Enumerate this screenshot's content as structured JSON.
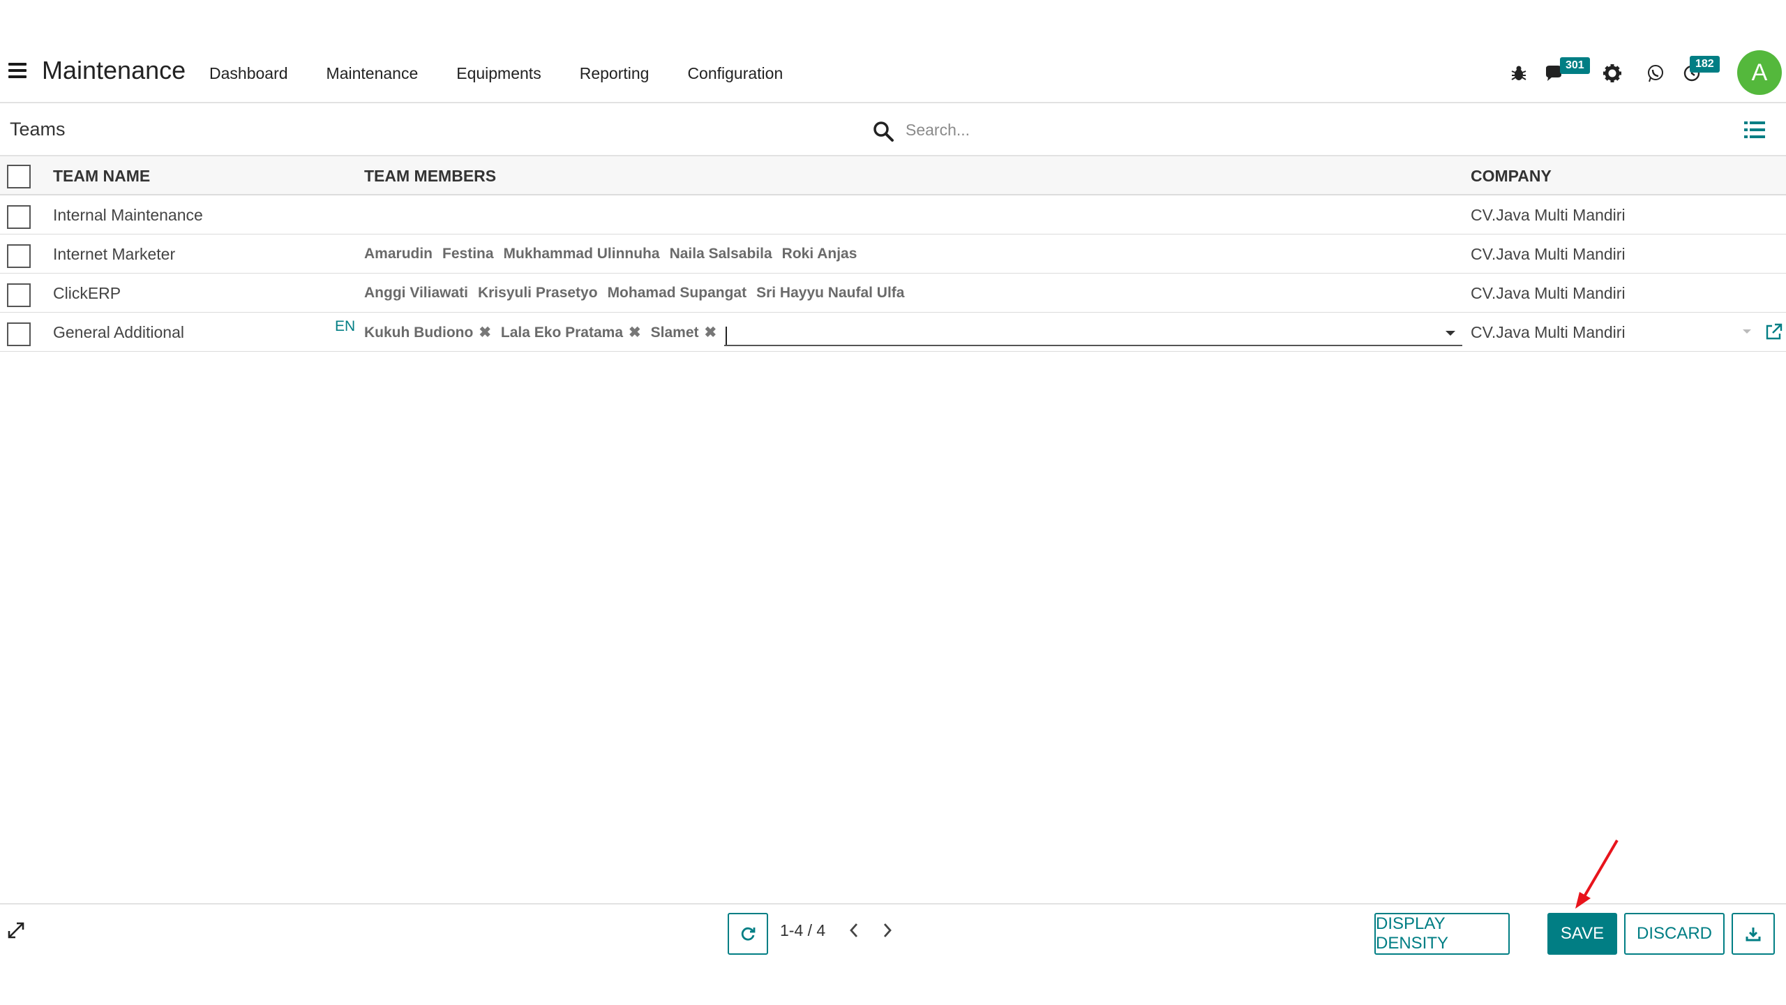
{
  "navbar": {
    "app_title": "Maintenance",
    "menu": [
      "Dashboard",
      "Maintenance",
      "Equipments",
      "Reporting",
      "Configuration"
    ],
    "messages_badge": "301",
    "activity_badge": "182",
    "avatar_letter": "A",
    "accent_color": "#017e84",
    "avatar_color": "#54b83c",
    "icons": [
      "bug-icon",
      "chat-icon",
      "gear-icon",
      "whatsapp-icon",
      "clock-icon"
    ]
  },
  "control": {
    "breadcrumb": "Teams",
    "search_placeholder": "Search..."
  },
  "table": {
    "columns": [
      "TEAM NAME",
      "TEAM MEMBERS",
      "COMPANY"
    ],
    "rows": [
      {
        "name": "Internal Maintenance",
        "members": [],
        "company": "CV.Java Multi Mandiri"
      },
      {
        "name": "Internet Marketer",
        "members": [
          "Amarudin",
          "Festina",
          "Mukhammad Ulinnuha",
          "Naila Salsabila",
          "Roki Anjas"
        ],
        "company": "CV.Java Multi Mandiri"
      },
      {
        "name": "ClickERP",
        "members": [
          "Anggi Viliawati",
          "Krisyuli Prasetyo",
          "Mohamad Supangat",
          "Sri Hayyu Naufal Ulfa"
        ],
        "company": "CV.Java Multi Mandiri"
      }
    ],
    "editing_row": {
      "name": "General Additional",
      "lang": "EN",
      "members": [
        "Kukuh Budiono",
        "Lala Eko Pratama",
        "Slamet"
      ],
      "company": "CV.Java Multi Mandiri"
    }
  },
  "footer": {
    "pager": "1-4 / 4",
    "buttons": {
      "display_density": "DISPLAY DENSITY",
      "save": "SAVE",
      "discard": "DISCARD"
    }
  }
}
